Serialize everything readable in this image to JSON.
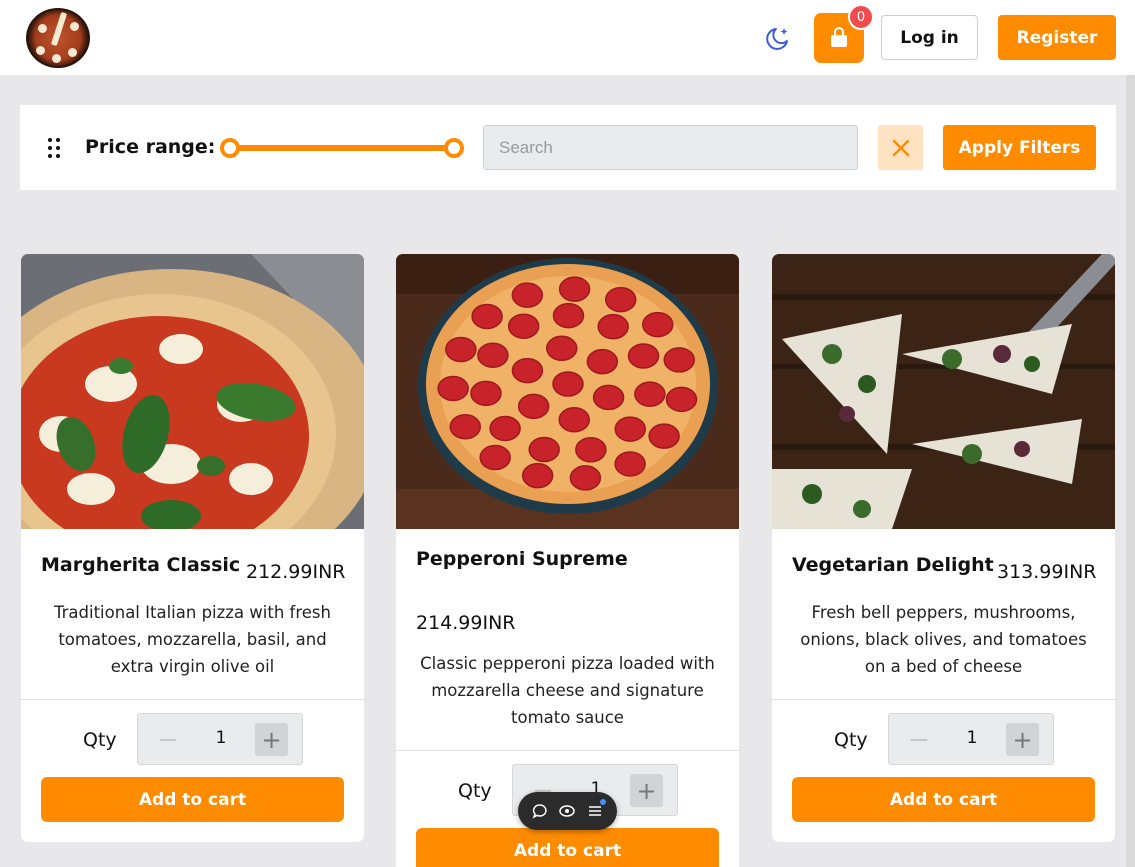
{
  "header": {
    "cart_count": "0",
    "login_label": "Log in",
    "register_label": "Register",
    "logo_icon": "pizza-logo",
    "theme_icon": "moon-stars-icon",
    "cart_icon": "shopping-bag-icon"
  },
  "filters": {
    "price_label": "Price range:",
    "price_range_fraction": [
      0,
      1
    ],
    "search_placeholder": "Search",
    "search_value": "",
    "clear_icon": "close-icon",
    "apply_label": "Apply Filters",
    "drag_icon": "drag-handle-icon"
  },
  "products": [
    {
      "name": "Margherita Classic",
      "price": "212.99INR",
      "description": "Traditional Italian pizza with fresh tomatoes, mozzarella, basil, and extra virgin olive oil",
      "qty_label": "Qty",
      "qty": "1",
      "add_label": "Add to cart"
    },
    {
      "name": "Pepperoni Supreme",
      "price": "214.99INR",
      "description": "Classic pepperoni pizza loaded with mozzarella cheese and signature tomato sauce",
      "qty_label": "Qty",
      "qty": "1",
      "add_label": "Add to cart"
    },
    {
      "name": "Vegetarian Delight",
      "price": "313.99INR",
      "description": "Fresh bell peppers, mushrooms, onions, black olives, and tomatoes on a bed of cheese",
      "qty_label": "Qty",
      "qty": "1",
      "add_label": "Add to cart"
    }
  ],
  "floating_toolbar": {
    "icons": [
      "comment-icon",
      "eye-icon",
      "menu-icon"
    ]
  },
  "colors": {
    "accent": "#ff8c00",
    "badge": "#f24b4b",
    "page_bg": "#e8e8ea",
    "theme_icon": "#3b5bdb"
  }
}
